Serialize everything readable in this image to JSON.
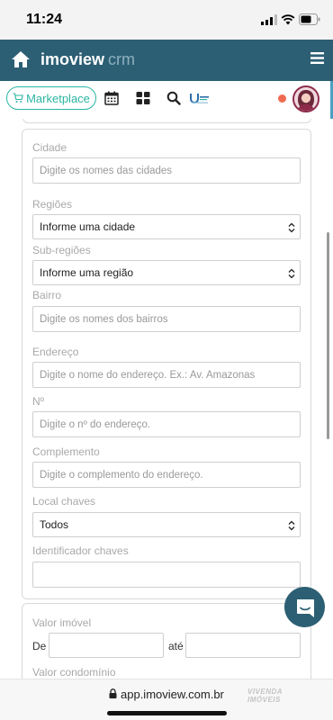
{
  "status_bar": {
    "time": "11:24"
  },
  "header": {
    "brand_main": "imoview",
    "brand_sub": "crm"
  },
  "toolbar": {
    "marketplace_label": "Marketplace"
  },
  "form": {
    "cidade": {
      "label": "Cidade",
      "placeholder": "Digite os nomes das cidades"
    },
    "regioes": {
      "label": "Regiões",
      "value": "Informe uma cidade"
    },
    "sub_regioes": {
      "label": "Sub-regiões",
      "value": "Informe uma região"
    },
    "bairro": {
      "label": "Bairro",
      "placeholder": "Digite os nomes dos bairros"
    },
    "endereco": {
      "label": "Endereço",
      "placeholder": "Digite o nome do endereço. Ex.: Av. Amazonas"
    },
    "numero": {
      "label": "Nº",
      "placeholder": "Digite o nº do endereço."
    },
    "complemento": {
      "label": "Complemento",
      "placeholder": "Digite o complemento do endereço."
    },
    "local_chaves": {
      "label": "Local chaves",
      "value": "Todos"
    },
    "identificador_chaves": {
      "label": "Identificador chaves",
      "value": ""
    }
  },
  "valores": {
    "valor_imovel": {
      "label": "Valor imóvel",
      "from_label": "De",
      "to_label": "até"
    },
    "valor_condominio": {
      "label": "Valor condomínio"
    }
  },
  "browser": {
    "url": "app.imoview.com.br",
    "watermark_line1": "VIVENDA",
    "watermark_line2": "IMÓVEIS"
  },
  "colors": {
    "header": "#2c5f74",
    "accent": "#2bb5a2",
    "notification": "#f06a4f"
  }
}
